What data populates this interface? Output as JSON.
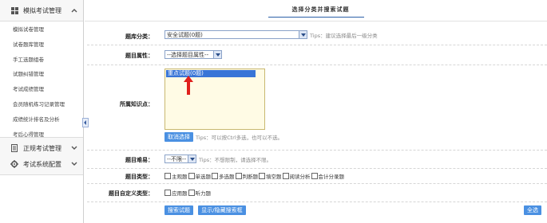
{
  "sidebar": {
    "section1": {
      "label": "模拟考试管理"
    },
    "items": [
      {
        "label": "模拟试卷管理"
      },
      {
        "label": "试卷题库管理"
      },
      {
        "label": "手工选题组卷"
      },
      {
        "label": "试题纠错管理"
      },
      {
        "label": "考试成绩管理"
      },
      {
        "label": "会员随机练习记录管理"
      },
      {
        "label": "成绩统计排名及分析"
      },
      {
        "label": "考后心得管理"
      }
    ],
    "section2": {
      "label": "正规考试管理"
    },
    "section3": {
      "label": "考试系统配置"
    }
  },
  "header": {
    "title": "选择分类并搜索试题"
  },
  "form": {
    "category": {
      "label": "题库分类：",
      "value": "安全试题(0题)",
      "tips": "Tips：建议选择最后一级分类"
    },
    "attribute": {
      "label": "题目属性：",
      "value": "--选择题目属性--"
    },
    "knowledge": {
      "label": "所属知识点：",
      "option": "重点试题(0题)",
      "cancel_button": "取消选择",
      "tips": "Tips：可以按Ctrl多选，也可以不选。"
    },
    "difficulty": {
      "label": "题目难易：",
      "value": "--不限--",
      "tips": "Tips：不想限制，请选择不限。"
    },
    "type": {
      "label": "题目类型：",
      "options": [
        "主观题",
        "单选题",
        "多选题",
        "判断题",
        "填空题",
        "阅读分析",
        "会计分录题"
      ]
    },
    "custom_type": {
      "label": "题目自定义类型：",
      "options": [
        "应用题",
        "听力题"
      ]
    },
    "search_button": "搜索试题",
    "toggle_button": "显示/隐藏搜索框",
    "select_all_button": "全选"
  },
  "colors": {
    "accent": "#4a90e2",
    "link_blue": "#2b5fa8",
    "annotation_red": "#e0201c"
  }
}
